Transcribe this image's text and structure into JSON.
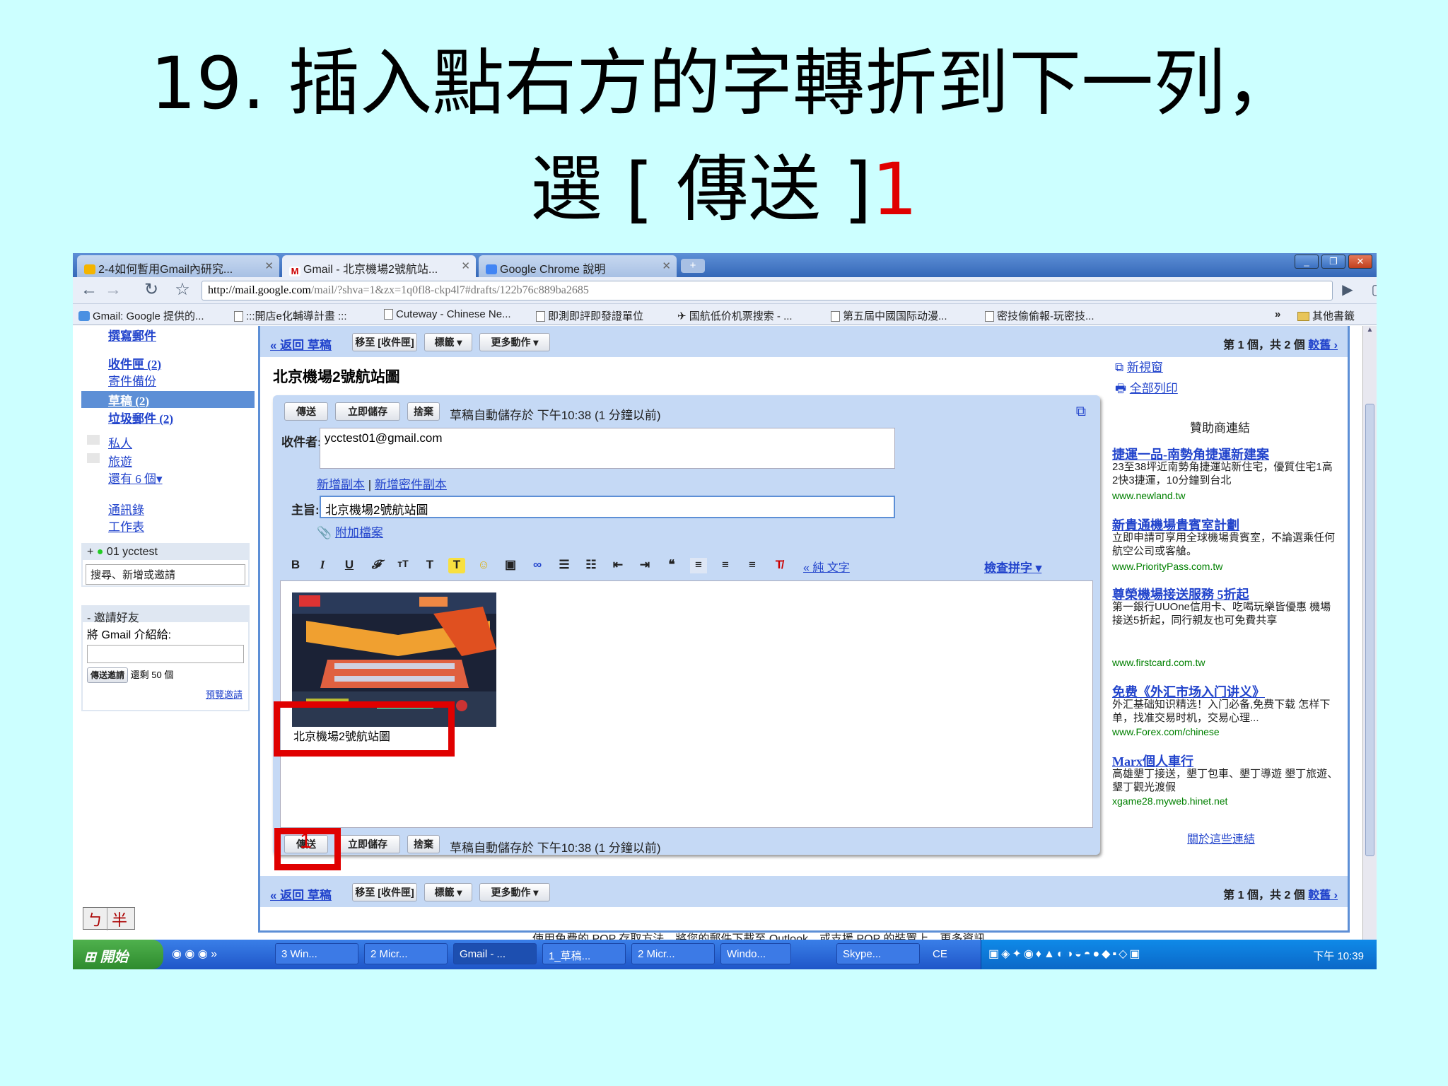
{
  "slide": {
    "line1": "19. 插入點右方的字轉折到下一列，",
    "line2_a": "選 [ 傳送 ]",
    "line2_b": "1"
  },
  "browser": {
    "tabs": [
      "2-4如何暫用Gmail內研究...",
      "Gmail - 北京機場2號航站...",
      "Google Chrome 說明"
    ],
    "url_host": "http://mail.google.com",
    "url_rest": "/mail/?shva=1&zx=1q0fl8-ckp4l7#drafts/122b76c889ba2685",
    "bookmarks": [
      "Gmail: Google 提供的...",
      ":::開店e化輔導計畫 :::",
      "Cuteway - Chinese Ne...",
      "即測即評即發證單位",
      "国航低价机票搜索 - ...",
      "第五屆中國国际动漫...",
      "密技偷偷報-玩密技...",
      "»",
      "其他書籤"
    ]
  },
  "leftnav": {
    "compose": "撰寫郵件",
    "inbox": "收件匣 (2)",
    "sent": "寄件備份",
    "drafts": "草稿 (2)",
    "spam": "垃圾郵件 (2)",
    "label1": "私人",
    "label2": "旅遊",
    "more": "還有 6 個▾",
    "contacts": "通訊錄",
    "tasks": "工作表",
    "chat_user": "01 ycctest",
    "chat_search": "搜尋、新增或邀請",
    "invite_title": "邀請好友",
    "invite_text": "將 Gmail 介紹給:",
    "invite_btn": "傳送邀請",
    "invite_left": "還剩 50 個",
    "invite_preview": "預覽邀請",
    "ime_a": "ㄅ",
    "ime_b": "半"
  },
  "actions": {
    "back": "« 返回 草稿",
    "move": "移至 [收件匣]",
    "labels": "標籤 ▾",
    "more": "更多動作 ▾",
    "count": "第 1 個，共 2 個",
    "older": "較舊 ›"
  },
  "compose": {
    "subject_title": "北京機場2號航站圖",
    "send": "傳送",
    "save": "立即儲存",
    "discard": "捨棄",
    "autosave": "草稿自動儲存於 下午10:38 (1 分鐘以前)",
    "to_label": "收件者:",
    "to_value": "ycctest01@gmail.com",
    "add_cc": "新增副本",
    "add_bcc": "新增密件副本",
    "sep": "|",
    "subject_label": "主旨:",
    "subject_value": "北京機場2號航站圖",
    "attach": "附加檔案",
    "plain_text": "« 純 文字",
    "spell": "檢查拼字 ▾",
    "caption": "北京機場2號航站圖",
    "marker": "1"
  },
  "right": {
    "new_window": "新視窗",
    "print_all": "全部列印",
    "sponsor": "贊助商連結",
    "about": "關於這些連結",
    "ads": [
      {
        "h": "捷運一品-南勢角捷運新建案",
        "t": "23至38坪近南勢角捷運站新住宅，優質住宅1高2快3捷運，10分鐘到台北",
        "u": "www.newland.tw"
      },
      {
        "h": "新貴通機場貴賓室計劃",
        "t": "立即申請可享用全球機場貴賓室，不論選乘任何航空公司或客艙。",
        "u": "www.PriorityPass.com.tw"
      },
      {
        "h": "尊榮機場接送服務 5折起",
        "t": "第一銀行UUOne信用卡、吃喝玩樂皆優惠 機場接送5折起，同行親友也可免費共享",
        "u": "www.firstcard.com.tw"
      },
      {
        "h": "免费《外汇市场入门讲义》",
        "t": "外汇基础知识精选！入门必备,免费下载 怎样下单，找准交易时机，交易心理...",
        "u": "www.Forex.com/chinese"
      },
      {
        "h": "Marx個人車行",
        "t": "高雄墾丁接送，墾丁包車、墾丁導遊 墾丁旅遊、墾丁觀光渡假",
        "u": "xgame28.myweb.hinet.net"
      }
    ]
  },
  "bottom_text": "使用免費的 POP 存取方法，將您的郵件下載至 Outlook，或支援 POP 的裝置上。更多資訊",
  "taskbar": {
    "start": "開始",
    "items": [
      "3 Win...",
      "2 Micr...",
      "Gmail - ...",
      "1_草稿...",
      "2 Micr...",
      "Windo...",
      "Skype..."
    ],
    "ce": "CE",
    "clock": "下午 10:39"
  }
}
